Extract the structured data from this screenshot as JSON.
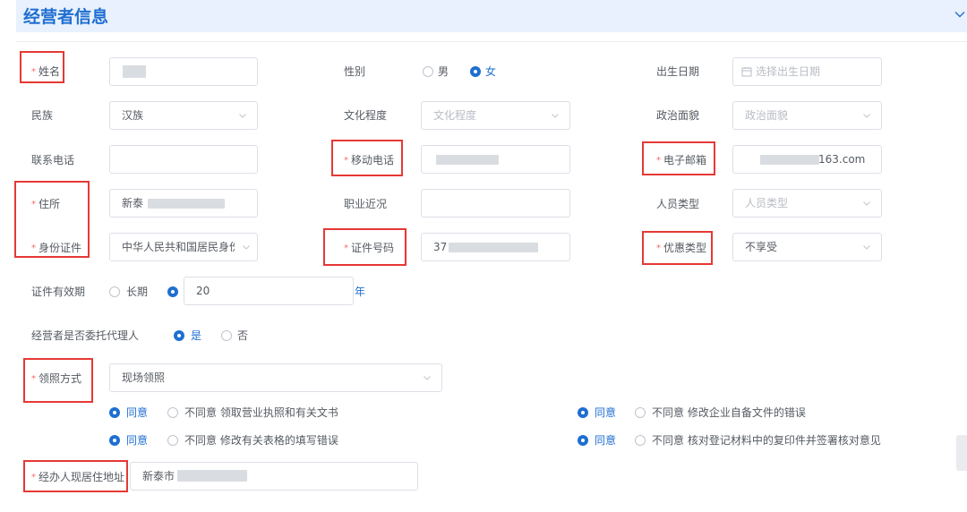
{
  "section": {
    "title": "经营者信息",
    "chevron_icon": "chevron-down-icon"
  },
  "fields": {
    "name": {
      "label": "姓名",
      "required": true,
      "value": ""
    },
    "gender": {
      "label": "性别",
      "options": [
        "男",
        "女"
      ],
      "selected": "女"
    },
    "birthdate": {
      "label": "出生日期",
      "placeholder": "选择出生日期",
      "icon": "calendar-icon"
    },
    "ethnicity": {
      "label": "民族",
      "value": "汉族"
    },
    "education": {
      "label": "文化程度",
      "placeholder": "文化程度"
    },
    "political": {
      "label": "政治面貌",
      "placeholder": "政治面貌"
    },
    "phone": {
      "label": "联系电话",
      "value": ""
    },
    "mobile": {
      "label": "移动电话",
      "required": true,
      "value": ""
    },
    "email": {
      "label": "电子邮箱",
      "required": true,
      "value_suffix": "163.com"
    },
    "residence": {
      "label": "住所",
      "required": true,
      "value_prefix": "新泰"
    },
    "occupation": {
      "label": "职业近况",
      "value": ""
    },
    "person_type": {
      "label": "人员类型",
      "placeholder": "人员类型"
    },
    "id_type": {
      "label": "身份证件",
      "required": true,
      "value": "中华人民共和国居民身份证"
    },
    "id_number": {
      "label": "证件号码",
      "required": true,
      "value_prefix": "37"
    },
    "discount": {
      "label": "优惠类型",
      "required": true,
      "value": "不享受"
    },
    "validity": {
      "label": "证件有效期",
      "options": [
        "长期"
      ],
      "selected": "years",
      "years_value": "20",
      "unit": "年"
    },
    "agent": {
      "label": "经营者是否委托代理人",
      "options": [
        "是",
        "否"
      ],
      "selected": "是"
    },
    "pickup": {
      "label": "领照方式",
      "required": true,
      "value": "现场领照"
    },
    "address": {
      "label": "经办人现居住地址",
      "required": true,
      "value_prefix": "新泰市"
    }
  },
  "consents": [
    {
      "agree": "同意",
      "disagree": "不同意",
      "text": "领取营业执照和有关文书",
      "selected": "同意"
    },
    {
      "agree": "同意",
      "disagree": "不同意",
      "text": "修改企业自备文件的错误",
      "selected": "同意"
    },
    {
      "agree": "同意",
      "disagree": "不同意",
      "text": "修改有关表格的填写错误",
      "selected": "同意"
    },
    {
      "agree": "同意",
      "disagree": "不同意",
      "text": "核对登记材料中的复印件并签署核对意见",
      "selected": "同意"
    }
  ],
  "colors": {
    "accent": "#1f6fd1",
    "required": "#f56c6c",
    "highlight_box": "#e53935",
    "header_bg": "#e8f1fd"
  }
}
